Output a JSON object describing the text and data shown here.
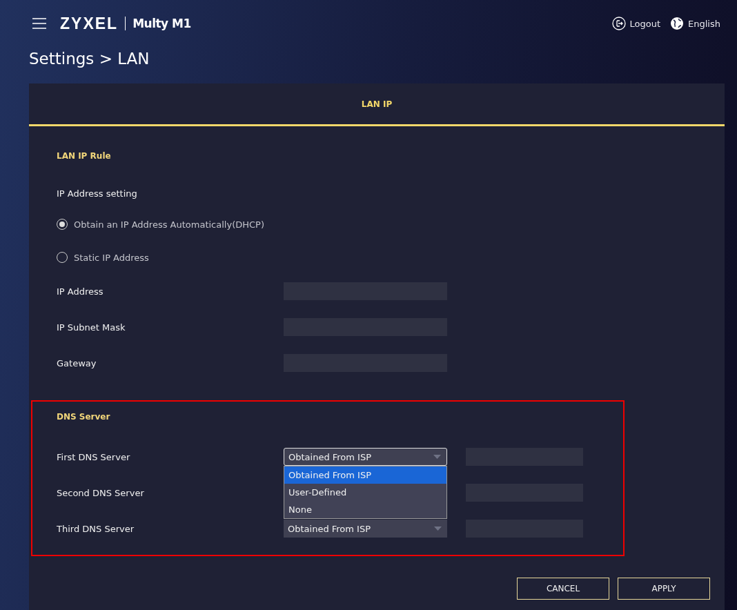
{
  "header": {
    "brand": "ZYXEL",
    "product": "Multy M1",
    "actions": [
      {
        "kind": "logout",
        "label": "Logout"
      },
      {
        "kind": "language",
        "label": "English"
      }
    ]
  },
  "page_title": "Settings > LAN",
  "tabs": [
    {
      "label": "LAN IP",
      "selected": true
    }
  ],
  "lan_ip_rule": {
    "title": "LAN IP Rule",
    "setting_label": "IP Address setting",
    "options": [
      {
        "label": "Obtain an IP Address Automatically(DHCP)",
        "selected": true
      },
      {
        "label": "Static IP Address",
        "selected": false
      }
    ],
    "fields": [
      {
        "label": "IP Address"
      },
      {
        "label": "IP Subnet Mask"
      },
      {
        "label": "Gateway"
      }
    ]
  },
  "dns_server": {
    "title": "DNS Server",
    "rows": [
      {
        "label": "First DNS Server",
        "value": "Obtained From ISP",
        "open": true
      },
      {
        "label": "Second DNS Server",
        "open": false
      },
      {
        "label": "Third DNS Server",
        "value": "Obtained From ISP",
        "open": false
      }
    ],
    "dropdown_options": [
      {
        "label": "Obtained From ISP",
        "selected": true
      },
      {
        "label": "User-Defined",
        "selected": false
      },
      {
        "label": "None",
        "selected": false
      }
    ]
  },
  "buttons": [
    {
      "label": "CANCEL"
    },
    {
      "label": "APPLY"
    }
  ]
}
